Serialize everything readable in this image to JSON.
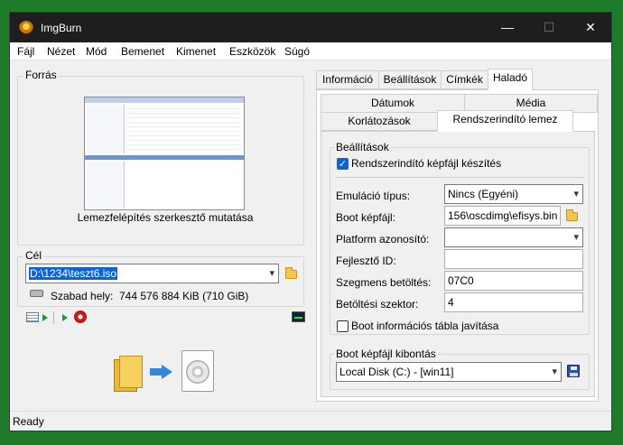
{
  "window": {
    "title": "ImgBurn",
    "minimize": "—",
    "maximize": "☐",
    "close": "✕"
  },
  "menu": [
    "Fájl",
    "Nézet",
    "Mód",
    "Bemenet",
    "Kimenet",
    "Eszközök",
    "Súgó"
  ],
  "source": {
    "group_label": "Forrás",
    "caption": "Lemezfelépítés szerkesztő mutatása"
  },
  "destination": {
    "group_label": "Cél",
    "path": "D:\\1234\\teszt6.iso",
    "free_space_label": "Szabad hely:",
    "free_space_value": "744 576 884 KiB  (710 GiB)"
  },
  "tabs": {
    "row1": [
      "Információ",
      "Beállítások",
      "Címkék",
      "Haladó"
    ],
    "row2a": [
      "Dátumok",
      "Média"
    ],
    "row2b": [
      "Korlátozások",
      "Rendszerindító lemez"
    ]
  },
  "boot": {
    "settings_group": "Beállítások",
    "make_bootable_label": "Rendszerindító képfájl készítés",
    "make_bootable_checked": true,
    "emulation_label": "Emuláció típus:",
    "emulation_value": "Nincs (Egyéni)",
    "boot_image_label": "Boot képfájl:",
    "boot_image_value": "156\\oscdimg\\efisys.bin",
    "platform_label": "Platform azonosító:",
    "platform_value": "",
    "developer_label": "Fejlesztő ID:",
    "developer_value": "",
    "load_segment_label": "Szegmens betöltés:",
    "load_segment_value": "07C0",
    "sectors_label": "Betöltési szektor:",
    "sectors_value": "4",
    "patch_label": "Boot információs tábla javítása",
    "patch_checked": false,
    "extract_group": "Boot képfájl kibontás",
    "extract_drive": "Local Disk (C:) - [win11]"
  },
  "status": "Ready",
  "colors": {
    "accent": "#0a64d8",
    "titlebar": "#1e1e1e",
    "background": "#1f7a2a"
  }
}
